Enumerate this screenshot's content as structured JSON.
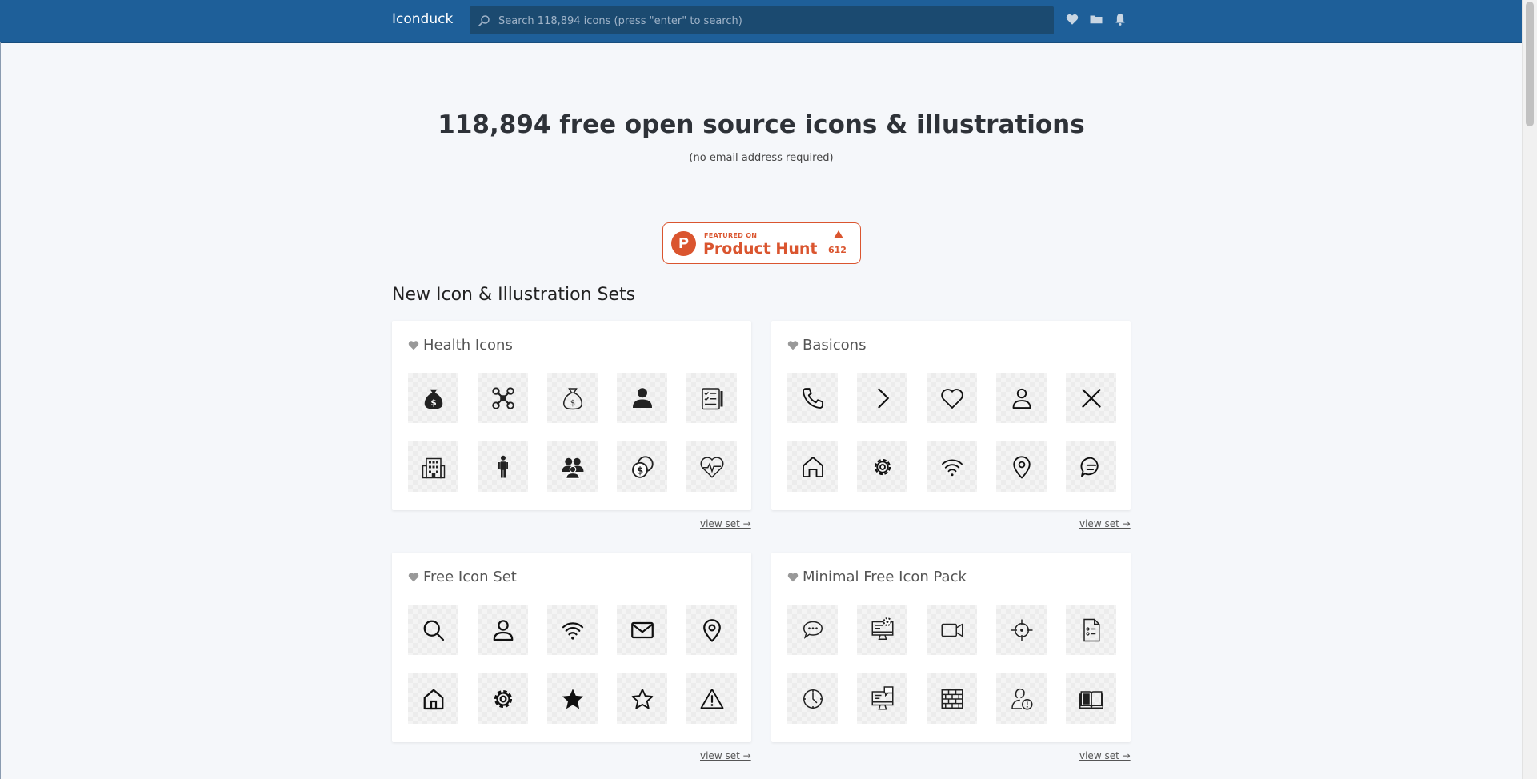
{
  "header": {
    "brand": "Iconduck",
    "search_placeholder": "Search 118,894 icons (press \"enter\" to search)",
    "icons": [
      "heart-icon",
      "folder-icon",
      "bell-icon"
    ]
  },
  "hero": {
    "title": "118,894 free open source icons & illustrations",
    "subtitle": "(no email address required)"
  },
  "product_hunt": {
    "logo_letter": "P",
    "featured": "FEATURED ON",
    "name": "Product Hunt",
    "votes": "612"
  },
  "section": {
    "title": "New Icon & Illustration Sets"
  },
  "sets": [
    {
      "title": "Health Icons",
      "link": "view set →",
      "icons": [
        "money-bag-icon",
        "drone-icon",
        "money-bag-outline-icon",
        "person-icon",
        "clipboard-checklist-icon",
        "hospital-building-icon",
        "standing-person-icon",
        "group-icon",
        "coins-icon",
        "heart-pulse-icon"
      ]
    },
    {
      "title": "Basicons",
      "link": "view set →",
      "icons": [
        "phone-icon",
        "chevron-right-icon",
        "heart-outline-icon",
        "user-outline-icon",
        "close-icon",
        "home-icon",
        "gear-icon",
        "wifi-icon",
        "location-pin-icon",
        "chat-bubble-icon"
      ]
    },
    {
      "title": "Free Icon Set",
      "link": "view set →",
      "icons": [
        "search-icon",
        "user-icon",
        "wifi-icon",
        "mail-icon",
        "location-pin-icon",
        "home-icon",
        "gear-icon",
        "star-filled-icon",
        "star-outline-icon",
        "warning-icon"
      ]
    },
    {
      "title": "Minimal Free Icon Pack",
      "link": "view set →",
      "icons": [
        "chat-icon",
        "desktop-settings-icon",
        "video-camera-icon",
        "crosshair-icon",
        "document-list-icon",
        "clock-icon",
        "desktop-chat-icon",
        "brick-wall-icon",
        "user-alert-icon",
        "book-icon"
      ]
    }
  ],
  "colors": {
    "header_bg": "#1e5f99",
    "search_bg": "#1b4a70",
    "product_hunt": "#da552f",
    "page_bg": "#f5f7fa"
  }
}
